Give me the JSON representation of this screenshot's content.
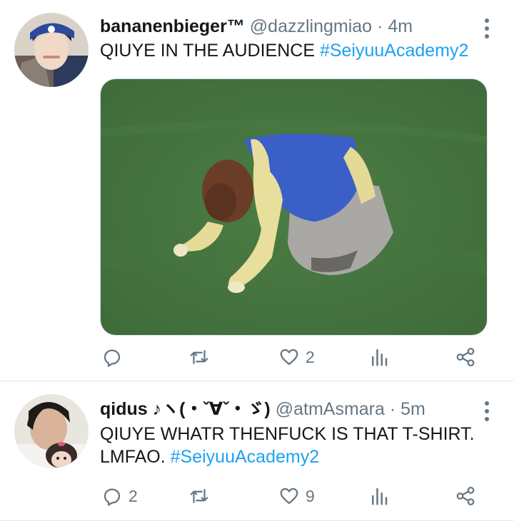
{
  "tweets": [
    {
      "display_name": "bananenbieger™",
      "handle": "@dazzlingmiao",
      "separator": "·",
      "time": "4m",
      "text": "QIUYE IN THE AUDIENCE ",
      "hashtag": "#SeiyuuAcademy2",
      "reply_count": "",
      "retweet_count": "",
      "like_count": "2"
    },
    {
      "display_name": "qidus ♪ヽ(・ˇ∀ˇ・ゞ)",
      "handle": "@atmAsmara",
      "separator": "·",
      "time": "5m",
      "text": "QIUYE WHATR THENFUCK IS THAT T-SHIRT. LMFAO. ",
      "hashtag": "#SeiyuuAcademy2",
      "reply_count": "2",
      "retweet_count": "",
      "like_count": "9"
    }
  ],
  "icons": {
    "reply": "reply-icon",
    "retweet": "retweet-icon",
    "like": "heart-icon",
    "analytics": "analytics-icon",
    "share": "share-icon",
    "more": "more-vertical-icon"
  },
  "colors": {
    "hashtag": "#1da1f2",
    "secondary": "#657786",
    "text": "#14171a",
    "divider": "#e1e8ed"
  }
}
